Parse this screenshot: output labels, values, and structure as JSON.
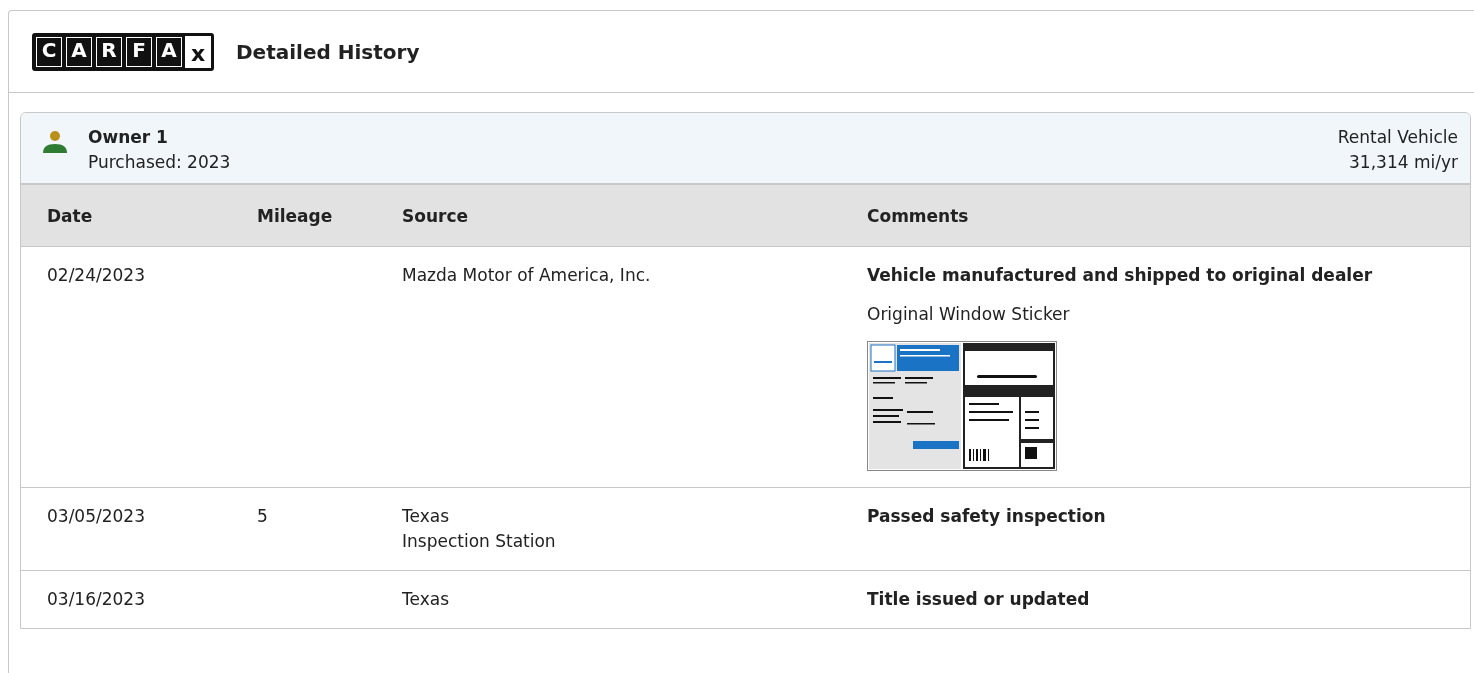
{
  "header": {
    "logo": {
      "letters": [
        "C",
        "A",
        "R",
        "F",
        "A"
      ],
      "suffix": "x"
    },
    "title": "Detailed History"
  },
  "owner": {
    "name": "Owner 1",
    "purchased": "Purchased: 2023",
    "type": "Rental Vehicle",
    "usage": "31,314 mi/yr"
  },
  "table": {
    "columns": [
      "Date",
      "Mileage",
      "Source",
      "Comments"
    ],
    "rows": [
      {
        "date": "02/24/2023",
        "mileage": "",
        "source": [
          "Mazda Motor of America, Inc."
        ],
        "comments": [
          {
            "kind": "heading",
            "text": "Vehicle manufactured and shipped to original dealer"
          },
          {
            "kind": "text",
            "text": "Original Window Sticker"
          },
          {
            "kind": "sticker"
          }
        ]
      },
      {
        "date": "03/05/2023",
        "mileage": "5",
        "source": [
          "Texas",
          "Inspection Station"
        ],
        "comments": [
          {
            "kind": "heading",
            "text": "Passed safety inspection"
          }
        ]
      },
      {
        "date": "03/16/2023",
        "mileage": "",
        "source": [
          "Texas"
        ],
        "comments": [
          {
            "kind": "heading",
            "text": "Title issued or updated"
          }
        ]
      }
    ]
  }
}
